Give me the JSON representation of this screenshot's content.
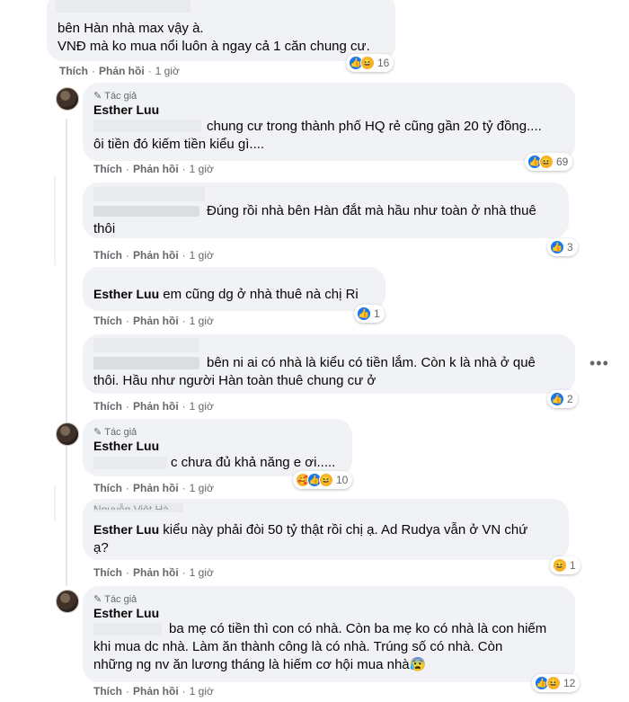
{
  "comments": [
    {
      "id": "c1",
      "author_tag": "",
      "name": "",
      "lines": [
        "bên Hàn nhà max vậy à.",
        "VNĐ mà ko mua nổi luôn à ngay cả 1 căn chung cư."
      ],
      "like": "Thích",
      "reply": "Phản hồi",
      "time": "1 giờ",
      "reaction_count": "16",
      "reactions": [
        "like",
        "haha"
      ]
    },
    {
      "id": "c2",
      "author_tag": "Tác giả",
      "name": "Esther Luu",
      "lines": [
        "chung cư trong thành phố HQ rẻ cũng gần 20 tỷ đồng....",
        "ôi tiền đó kiếm tiền kiểu gì...."
      ],
      "like": "Thích",
      "reply": "Phản hồi",
      "time": "1 giờ",
      "reaction_count": "69",
      "reactions": [
        "like",
        "haha"
      ]
    },
    {
      "id": "c3",
      "author_tag": "",
      "name": "",
      "lines": [
        "Đúng rồi nhà bên Hàn đắt mà hầu như toàn ở nhà thuê",
        "thôi"
      ],
      "like": "Thích",
      "reply": "Phản hồi",
      "time": "1 giờ",
      "reaction_count": "3",
      "reactions": [
        "like"
      ]
    },
    {
      "id": "c4",
      "author_tag": "",
      "name": "Esther Luu",
      "lines": [
        "em cũng dg ở nhà thuê nà chị Ri"
      ],
      "like": "Thích",
      "reply": "Phản hồi",
      "time": "1 giờ",
      "reaction_count": "1",
      "reactions": [
        "like"
      ]
    },
    {
      "id": "c5",
      "author_tag": "",
      "name": "",
      "lines": [
        "bên ni ai có nhà là kiểu có tiền lắm. Còn k là nhà ở quê",
        "thôi. Hầu như người Hàn toàn thuê chung cư ở"
      ],
      "like": "Thích",
      "reply": "Phản hồi",
      "time": "1 giờ",
      "reaction_count": "2",
      "reactions": [
        "like"
      ]
    },
    {
      "id": "c6",
      "author_tag": "Tác giả",
      "name": "Esther Luu",
      "lines": [
        "c chưa đủ khả năng e ơi....."
      ],
      "like": "Thích",
      "reply": "Phản hồi",
      "time": "1 giờ",
      "reaction_count": "10",
      "reactions": [
        "care",
        "like",
        "haha"
      ]
    },
    {
      "id": "c7",
      "author_tag": "",
      "name": "Esther Luu",
      "lines": [
        "kiểu này phải đòi 50 tỷ thật rồi chị ạ. Ad Rudya vẫn ở VN chứ",
        "ạ?"
      ],
      "like": "Thích",
      "reply": "Phản hồi",
      "time": "1 giờ",
      "reaction_count": "1",
      "reactions": [
        "haha"
      ]
    },
    {
      "id": "c8",
      "author_tag": "Tác giả",
      "name": "Esther Luu",
      "lines": [
        "ba mẹ có tiền thì con có nhà. Còn ba mẹ ko có nhà là con hiếm",
        "khi mua dc nhà. Làm ăn thành công là có nhà. Trúng số có nhà. Còn",
        "những ng nv ăn lương tháng là hiếm cơ hội mua nhà😰"
      ],
      "like": "Thích",
      "reply": "Phản hồi",
      "time": "1 giờ",
      "reaction_count": "12",
      "reactions": [
        "like",
        "haha"
      ]
    }
  ],
  "more_options": "•••",
  "partial_name": "Nguyễn Việt Hà",
  "icons": {
    "pen": "pen-icon",
    "like": "like-icon",
    "haha": "haha-icon",
    "care": "care-icon",
    "sad": "sad-icon"
  },
  "colors": {
    "bubble": "#f0f2f5",
    "like": "#1877f2",
    "reaction_yellow": "#f7b125",
    "meta": "#65676b"
  }
}
